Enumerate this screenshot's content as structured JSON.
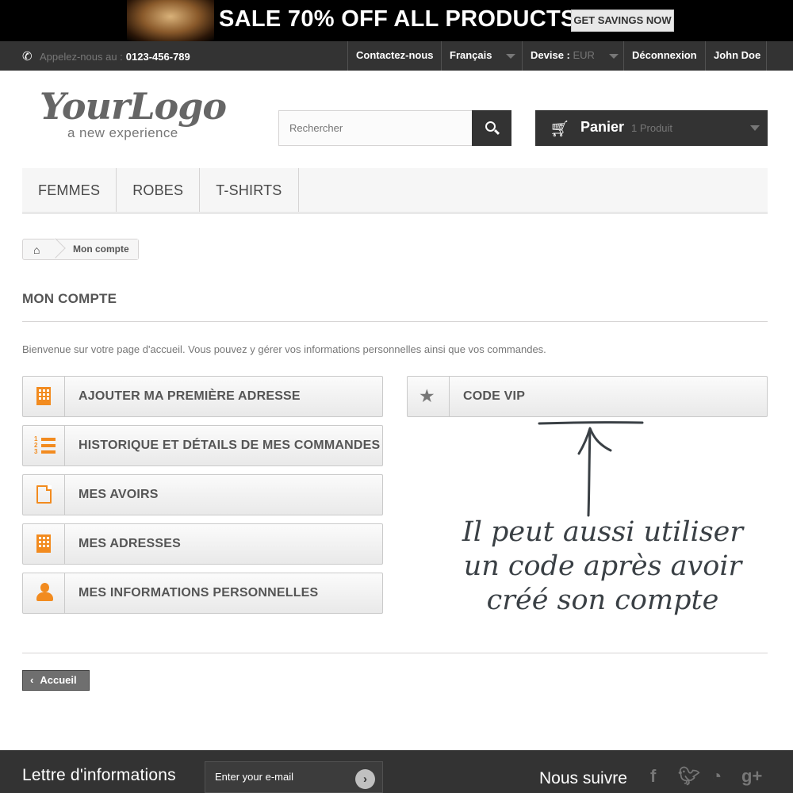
{
  "promo": {
    "text": "SALE 70% OFF ALL PRODUCTS",
    "button": "GET SAVINGS NOW"
  },
  "topnav": {
    "phone_prefix": "Appelez-nous au :",
    "phone_number": "0123-456-789",
    "contact": "Contactez-nous",
    "language": "Français",
    "currency_label": "Devise :",
    "currency_value": "EUR",
    "logout": "Déconnexion",
    "user": "John Doe"
  },
  "header": {
    "logo_main": "YourLogo",
    "logo_sub": "a new experience",
    "search_placeholder": "Rechercher",
    "cart_label": "Panier",
    "cart_count": "1 Produit"
  },
  "menu": {
    "items": [
      "FEMMES",
      "ROBES",
      "T-SHIRTS"
    ]
  },
  "breadcrumb": {
    "current": "Mon compte"
  },
  "page": {
    "title": "MON COMPTE",
    "welcome": "Bienvenue sur votre page d'accueil. Vous pouvez y gérer vos informations personnelles ainsi que vos commandes."
  },
  "account_links": {
    "add_address": "AJOUTER MA PREMIÈRE ADRESSE",
    "order_history": "HISTORIQUE ET DÉTAILS DE MES COMMANDES",
    "credit_slips": "MES AVOIRS",
    "addresses": "MES ADRESSES",
    "personal_info": "MES INFORMATIONS PERSONNELLES",
    "vip_code": "CODE VIP"
  },
  "annotation": {
    "line1": "Il peut aussi utiliser",
    "line2": "un code après avoir",
    "line3": "créé son compte"
  },
  "home_button": "Accueil",
  "footer": {
    "newsletter_title": "Lettre d'informations",
    "newsletter_placeholder": "Enter your e-mail",
    "follow_title": "Nous suivre",
    "social_icons": [
      "facebook-icon",
      "twitter-icon",
      "rss-icon",
      "google-plus-icon"
    ]
  },
  "colors": {
    "accent_orange": "#f28b1f",
    "dark_bar": "#333333",
    "promo_bg": "#000000"
  }
}
